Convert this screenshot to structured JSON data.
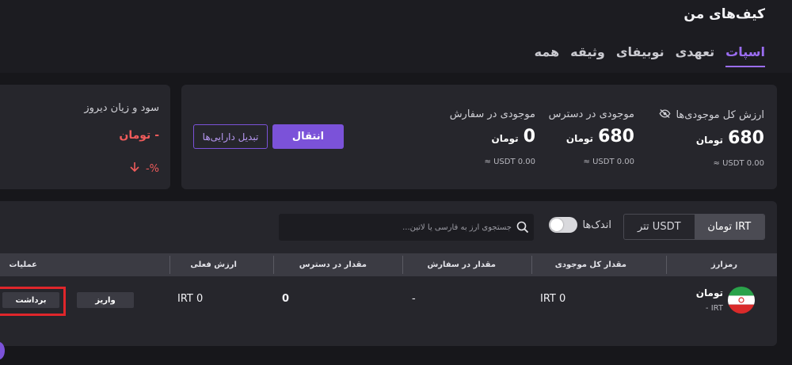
{
  "header": {
    "title": "کیف‌های من",
    "tabs": [
      {
        "label": "اسپات",
        "active": true
      },
      {
        "label": "تعهدی",
        "active": false
      },
      {
        "label": "نوبیفای",
        "active": false
      },
      {
        "label": "وثیقه",
        "active": false
      },
      {
        "label": "همه",
        "active": false
      }
    ]
  },
  "summary": {
    "total": {
      "label": "ارزش کل موجودی‌ها",
      "value": "680",
      "unit": "تومان",
      "usdt": "≈ USDT 0.00",
      "icon": "eye-off-icon"
    },
    "available": {
      "label": "موجودی در دسترس",
      "value": "680",
      "unit": "تومان",
      "usdt": "≈ USDT 0.00"
    },
    "in_order": {
      "label": "موجودی در سفارش",
      "value": "0",
      "unit": "تومان",
      "usdt": "≈ USDT 0.00"
    },
    "transfer_button": "انتقال",
    "convert_button": "تبدیل دارایی‌ها"
  },
  "pnl": {
    "label": "سود و زیان دیروز",
    "value": "- تومان",
    "percent": "-%",
    "icon": "arrow-down-icon"
  },
  "filters": {
    "currency_options": [
      {
        "label": "تومان IRT",
        "selected": true
      },
      {
        "label": "تتر USDT",
        "selected": false
      }
    ],
    "dust_label": "اندک‌ها",
    "search_placeholder": "جستجوی ارز به فارسی یا لاتین..."
  },
  "table": {
    "columns": [
      "رمزارز",
      "مقدار کل موجودی",
      "مقدار در سفارش",
      "مقدار در دسترس",
      "ارزش فعلی",
      "عملیات"
    ],
    "rows": [
      {
        "name": "تومان",
        "symbol": "IRT -",
        "total": "IRT 0",
        "in_order": "-",
        "available": "0",
        "value": "IRT 0",
        "deposit": "واریز",
        "withdraw": "برداشت"
      }
    ]
  },
  "colors": {
    "accent": "#7b52d9",
    "negative": "#ef5b5b",
    "highlight": "#e0262b"
  }
}
